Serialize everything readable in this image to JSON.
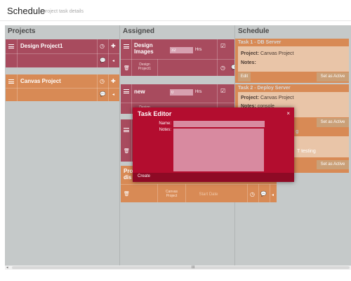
{
  "header": {
    "title": "Schedule",
    "subtitle": "project task details"
  },
  "columns": {
    "projects": "Projects",
    "assigned": "Assigned",
    "schedule": "Schedule"
  },
  "projects": [
    {
      "name": "Design Project1",
      "color": "#a84b5e"
    },
    {
      "name": "Canvas Project",
      "color": "#d88a55"
    }
  ],
  "assigned": [
    {
      "title_line1": "Design",
      "title_line2": "Images",
      "hours_value": "32",
      "hours_label": "Hrs",
      "project_line1": "Design",
      "project_line2": "Project1",
      "color": "#a84b5e"
    },
    {
      "title": "new",
      "hours_value": "0",
      "hours_label": "Hrs",
      "project_line1": "Design",
      "color": "#a84b5e"
    },
    {
      "title_line1": "Pro",
      "title_line2": "dis",
      "project_line1": "Canvas",
      "project_line2": "Project",
      "date_placeholder": "Start Date",
      "color": "#d88a55"
    }
  ],
  "schedule": [
    {
      "title": "Task 1 - DB Server",
      "project_label": "Project:",
      "project_value": "Canvas Project",
      "notes_label": "Notes:",
      "edit_label": "Edit",
      "set_active_label": "Set as Active"
    },
    {
      "title": "Task 2 - Deploy Server",
      "project_label": "Project:",
      "project_value": "Canvas Project",
      "notes_label": "Notes:",
      "notes_value": "console",
      "set_active_label": "Set as Active"
    },
    {
      "partial_title": "g",
      "notes_partial": "T testing",
      "set_active_label": "Set as Active"
    }
  ],
  "dialog": {
    "title": "Task Editor",
    "close_glyph": "×",
    "name_label": "Name:",
    "notes_label": "Notes:",
    "create_label": "Create"
  },
  "scroll": {
    "grip": "III",
    "left_arrow": "◂"
  }
}
